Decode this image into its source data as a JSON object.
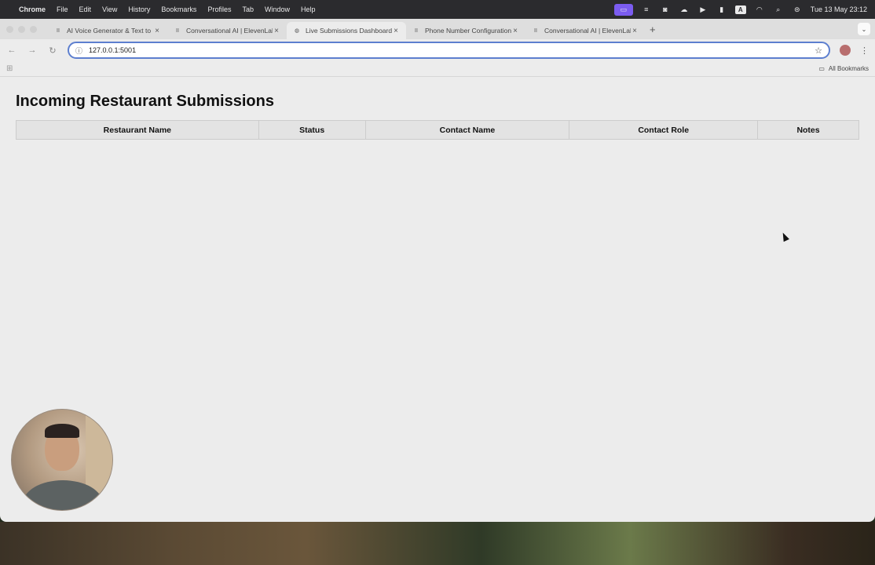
{
  "menubar": {
    "app": "Chrome",
    "items": [
      "File",
      "Edit",
      "View",
      "History",
      "Bookmarks",
      "Profiles",
      "Tab",
      "Window",
      "Help"
    ],
    "keyboard_indicator": "A",
    "datetime": "Tue 13 May  23:12"
  },
  "browser": {
    "tabs": [
      {
        "title": "AI Voice Generator & Text to Speech",
        "active": false
      },
      {
        "title": "Conversational AI | ElevenLabs",
        "active": false
      },
      {
        "title": "Live Submissions Dashboard",
        "active": true
      },
      {
        "title": "Phone Number Configuration",
        "active": false
      },
      {
        "title": "Conversational AI | ElevenLabs",
        "active": false
      }
    ],
    "url": "127.0.0.1:5001",
    "bookmarks_label": "All Bookmarks"
  },
  "page": {
    "title": "Incoming Restaurant Submissions",
    "table": {
      "columns": [
        "Restaurant Name",
        "Status",
        "Contact Name",
        "Contact Role",
        "Notes"
      ],
      "rows": []
    }
  }
}
